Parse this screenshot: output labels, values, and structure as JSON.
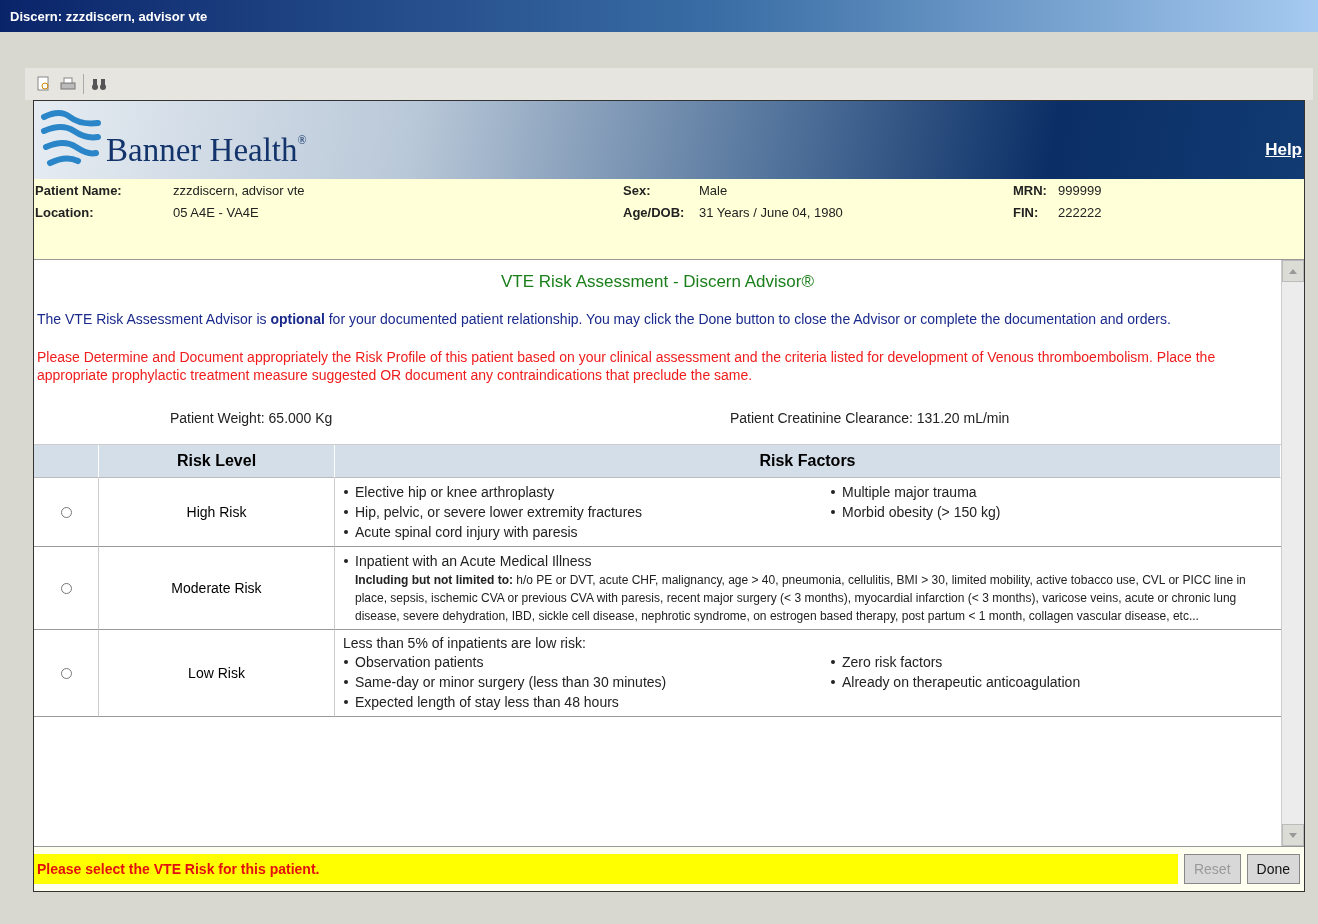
{
  "window": {
    "title": "Discern: zzzdiscern, advisor vte"
  },
  "banner": {
    "logo_text": "Banner Health$^{®}$",
    "help_link": "Help"
  },
  "patient": {
    "fields": [
      {
        "label": "Patient Name:",
        "value": "zzzdiscern, advisor vte"
      },
      {
        "label": "Sex:",
        "value": "Male"
      },
      {
        "label": "MRN:",
        "value": "999999"
      },
      {
        "label": "Location:",
        "value": "05 A4E - VA4E"
      },
      {
        "label": "Age/DOB:",
        "value": "31 Years / June 04, 1980"
      },
      {
        "label": "FIN:",
        "value": "222222"
      }
    ]
  },
  "content": {
    "heading": "VTE Risk Assessment - Discern Advisor®",
    "intro": "The VTE Risk Assessment Advisor is **optional** for your documented patient relationship. You may click the Done button to close the Advisor or complete the documentation and orders.",
    "instruction": "Please Determine and Document appropriately the Risk Profile of this patient based on your clinical assessment and the criteria listed for development of Venous thromboembolism. Place the appropriate prophylactic treatment measure suggested OR document any contraindications that preclude the same.",
    "measurements": [
      "Patient Weight:  65.000 Kg",
      "Patient Creatinine Clearance:  131.20 mL/min"
    ],
    "table": {
      "columns": [
        "Risk Level",
        "Risk Factors"
      ],
      "rows": [
        {
          "selected": false,
          "level": "High Risk",
          "left": [
            "Elective hip or knee arthroplasty",
            "Hip, pelvic, or severe lower extremity fractures",
            "Acute spinal cord injury with paresis"
          ],
          "right": [
            "Multiple major trauma",
            "Morbid obesity (> 150 kg)"
          ]
        },
        {
          "selected": false,
          "level": "Moderate Risk",
          "left": [
            "Inpatient with an Acute Medical Illness"
          ],
          "note": "**Including but not limited to:** h/o PE or DVT, acute CHF, malignancy, age > 40, pneumonia, cellulitis, BMI > 30, limited mobility, active tobacco use, CVL or PICC line in place, sepsis, ischemic CVA or previous CVA with paresis, recent major surgery (< 3 months), myocardial infarction (< 3 months), varicose veins, acute or chronic lung disease, severe dehydration, IBD, sickle cell disease, nephrotic syndrome, on estrogen based therapy, post partum < 1 month, collagen vascular disease, etc..."
        },
        {
          "selected": false,
          "level": "Low Risk",
          "lead": "Less than 5% of inpatients are low risk:",
          "left": [
            "Observation patients",
            "Same-day or minor surgery (less than 30 minutes)",
            "Expected length of stay less than 48 hours"
          ],
          "right": [
            "Zero risk factors",
            "Already on therapeutic anticoagulation"
          ]
        }
      ]
    }
  },
  "footer": {
    "message": "Please select the VTE Risk for this patient.",
    "buttons": [
      {
        "label": "Reset",
        "disabled": true
      },
      {
        "label": "Done",
        "disabled": false
      }
    ]
  }
}
